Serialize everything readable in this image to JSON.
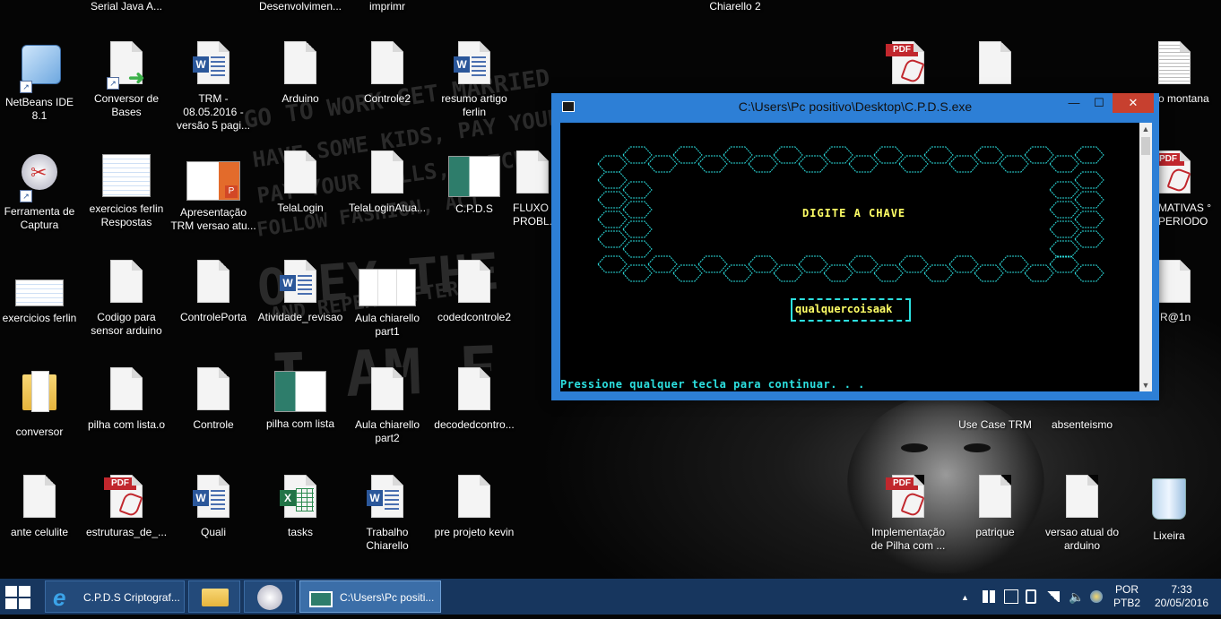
{
  "top_labels": [
    "Serial Java A...",
    "Desenvolvimen...",
    "imprimr",
    "Chiarello 2"
  ],
  "icons": [
    {
      "label": "NetBeans IDE 8.1",
      "kind": "netbeans"
    },
    {
      "label": "Conversor de Bases",
      "kind": "exe"
    },
    {
      "label": "TRM - 08.05.2016 - versão 5 pagi...",
      "kind": "word"
    },
    {
      "label": "Arduino",
      "kind": "file"
    },
    {
      "label": "Controle2",
      "kind": "file"
    },
    {
      "label": "resumo artigo ferlin",
      "kind": "word"
    },
    {
      "label": "Ferramenta de Captura",
      "kind": "snip"
    },
    {
      "label": "exercicios ferlin Respostas",
      "kind": "thumb"
    },
    {
      "label": "Apresentação TRM versao atu...",
      "kind": "ppt"
    },
    {
      "label": "TelaLogin",
      "kind": "file"
    },
    {
      "label": "TelaLoginAtua...",
      "kind": "file"
    },
    {
      "label": "C.P.D.S",
      "kind": "app"
    },
    {
      "label": "FLUXO PROBL...",
      "kind": "file"
    },
    {
      "label": "exercicios ferlin",
      "kind": "thumb"
    },
    {
      "label": "Codigo para sensor arduino",
      "kind": "file"
    },
    {
      "label": "ControlePorta",
      "kind": "file"
    },
    {
      "label": "Atividade_revisao",
      "kind": "word"
    },
    {
      "label": "Aula chiarello part1",
      "kind": "thumb"
    },
    {
      "label": "codedcontrole2",
      "kind": "file"
    },
    {
      "label": "conversor",
      "kind": "folder"
    },
    {
      "label": "pilha com lista.o",
      "kind": "file"
    },
    {
      "label": "Controle",
      "kind": "file"
    },
    {
      "label": "pilha com lista",
      "kind": "app"
    },
    {
      "label": "Aula chiarello part2",
      "kind": "file"
    },
    {
      "label": "decodedcontro...",
      "kind": "file"
    },
    {
      "label": "ante celulite",
      "kind": "file"
    },
    {
      "label": "estruturas_de_...",
      "kind": "pdf"
    },
    {
      "label": "Quali",
      "kind": "word"
    },
    {
      "label": "tasks",
      "kind": "excel"
    },
    {
      "label": "Trabalho Chiarello",
      "kind": "word"
    },
    {
      "label": "pre projeto kevin",
      "kind": "file"
    },
    {
      "label": "",
      "kind": "pdf"
    },
    {
      "label": "",
      "kind": "file"
    },
    {
      "label": "o montana",
      "kind": "doc"
    },
    {
      "label": "MATIVAS ° PERIODO",
      "kind": "pdf"
    },
    {
      "label": "R@1n",
      "kind": "file"
    },
    {
      "label": "Use Case TRM",
      "kind": "file"
    },
    {
      "label": "absenteismo",
      "kind": "file"
    },
    {
      "label": "Implementação de Pilha com ...",
      "kind": "pdf"
    },
    {
      "label": "patrique",
      "kind": "file"
    },
    {
      "label": "versao atual do arduino",
      "kind": "file"
    },
    {
      "label": "Lixeira",
      "kind": "recycle"
    }
  ],
  "window": {
    "title": "C:\\Users\\Pc positivo\\Desktop\\C.P.D.S.exe",
    "minimize": "—",
    "maximize": "☐",
    "close": "✕",
    "prompt": "DIGITE A CHAVE",
    "key_value": "qualquercoisaak",
    "continue_msg": "Pressione qualquer tecla para continuar. . ."
  },
  "taskbar": {
    "buttons": [
      {
        "label": "C.P.D.S Criptograf...",
        "icon": "ie-icon"
      },
      {
        "label": "",
        "icon": "explorer-icon"
      },
      {
        "label": "",
        "icon": "snipping-tool-icon"
      },
      {
        "label": "C:\\Users\\Pc positi...",
        "icon": "console-icon"
      }
    ],
    "tray": {
      "lang_top": "POR",
      "lang_bottom": "PTB2",
      "time": "7:33",
      "date": "20/05/2016",
      "chevron": "▲"
    }
  },
  "colors": {
    "taskbar": "#17365e",
    "window_border": "#2d7fd6",
    "console_text_cyan": "#2ce0e0",
    "console_text_yellow": "#ffff66",
    "close_button": "#c7402f"
  }
}
